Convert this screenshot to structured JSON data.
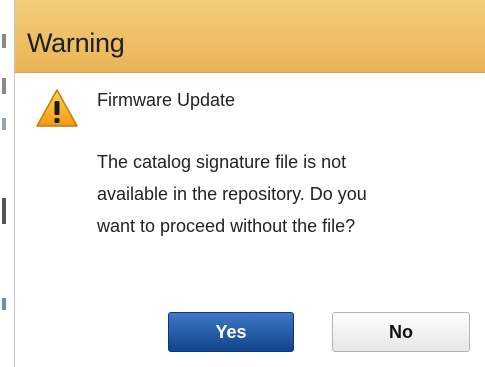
{
  "dialog": {
    "title": "Warning",
    "icon": "warning-triangle-icon",
    "heading": "Firmware Update",
    "message_lines": [
      "The catalog signature file is not",
      "available in the repository. Do you",
      "want to proceed without the file?"
    ],
    "buttons": {
      "yes_label": "Yes",
      "no_label": "No"
    }
  },
  "colors": {
    "titlebar": "#eebf63",
    "primary_button": "#1a4f9c",
    "warning_icon": "#f2a71b"
  }
}
